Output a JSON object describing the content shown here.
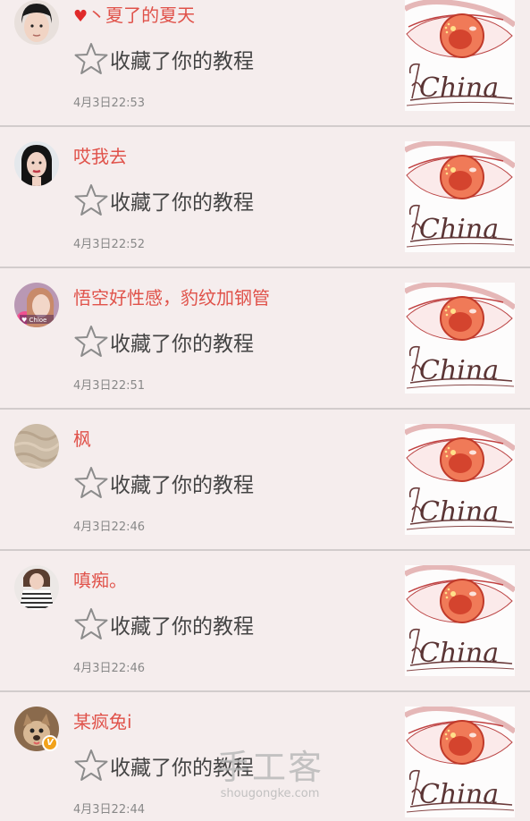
{
  "accent_color": "#e0524a",
  "items": [
    {
      "username": "丶夏了的夏天",
      "has_heart": true,
      "action": "收藏了你的教程",
      "time": "4月3日22:53",
      "avatar": "girl-short-hair",
      "verified": false
    },
    {
      "username": "哎我去",
      "has_heart": false,
      "action": "收藏了你的教程",
      "time": "4月3日22:52",
      "avatar": "woman-dark-hair",
      "verified": false
    },
    {
      "username": "悟空好性感，豹纹加钢管",
      "has_heart": false,
      "action": "收藏了你的教程",
      "time": "4月3日22:51",
      "avatar": "girl-pink-photo",
      "verified": false
    },
    {
      "username": "枫",
      "has_heart": false,
      "action": "收藏了你的教程",
      "time": "4月3日22:46",
      "avatar": "beige-texture",
      "verified": false
    },
    {
      "username": "嗔痴。",
      "has_heart": false,
      "action": "收藏了你的教程",
      "time": "4月3日22:46",
      "avatar": "striped-shirt",
      "verified": false
    },
    {
      "username": "某疯兔i",
      "has_heart": false,
      "action": "收藏了你的教程",
      "time": "4月3日22:44",
      "avatar": "pet-photo",
      "verified": true,
      "verified_mark": "V"
    }
  ],
  "watermark": {
    "main": "手工客",
    "sub": "shougongke.com"
  }
}
